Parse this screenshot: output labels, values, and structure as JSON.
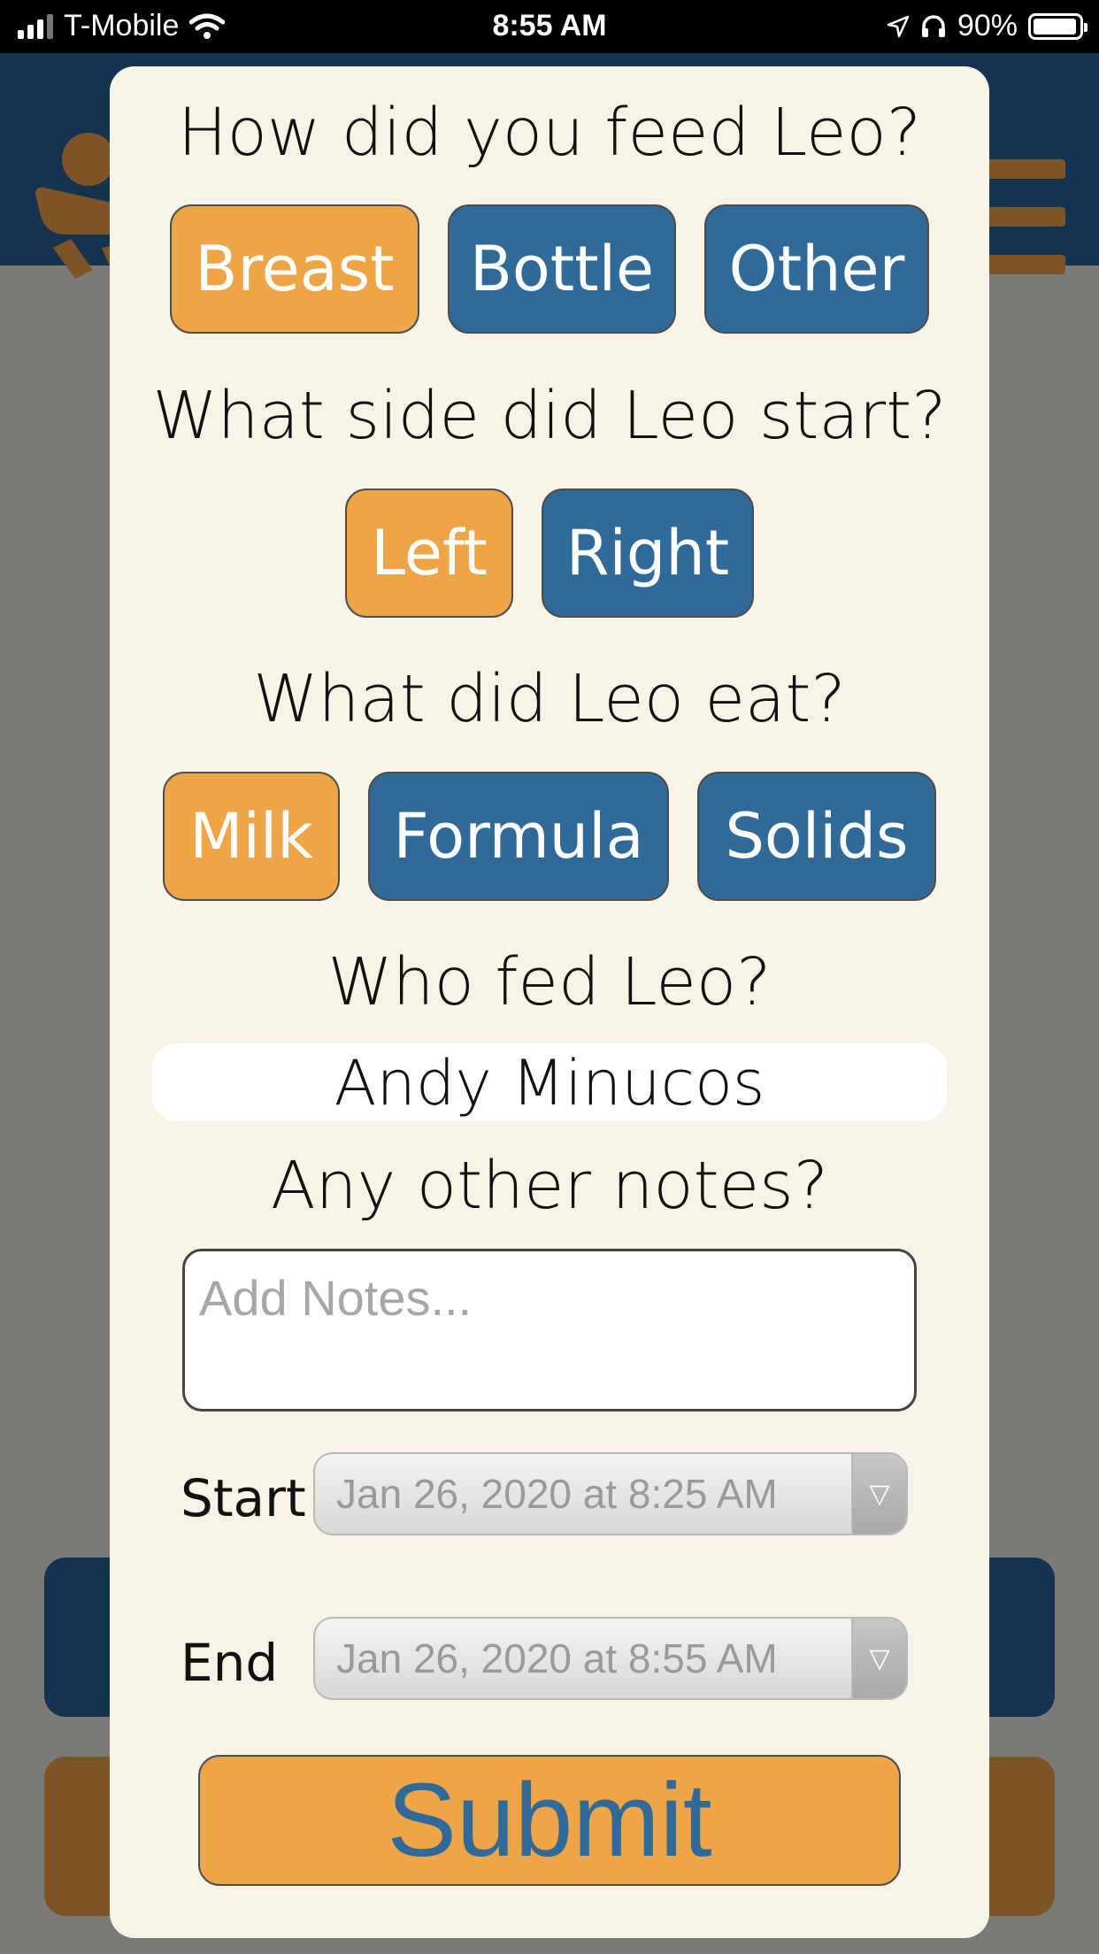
{
  "status_bar": {
    "carrier": "T-Mobile",
    "time": "8:55 AM",
    "battery": "90%"
  },
  "colors": {
    "selected": "#eea548",
    "unselected": "#2f6a98",
    "header": "#14344f",
    "modal_bg": "#f8f3e7"
  },
  "form": {
    "feed_question": "How did you feed Leo?",
    "feed_options": [
      "Breast",
      "Bottle",
      "Other"
    ],
    "feed_selected": "Breast",
    "side_question": "What side did Leo start?",
    "side_options": [
      "Left",
      "Right"
    ],
    "side_selected": "Left",
    "eat_question": "What did Leo eat?",
    "eat_options": [
      "Milk",
      "Formula",
      "Solids"
    ],
    "eat_selected": "Milk",
    "fed_by_question": "Who fed Leo?",
    "fed_by": "Andy Minucos",
    "notes_question": "Any other notes?",
    "notes_placeholder": "Add Notes...",
    "notes_value": "",
    "start_label": "Start",
    "start_value": "Jan 26, 2020 at 8:25 AM",
    "end_label": "End",
    "end_value": "Jan 26, 2020 at 8:55 AM",
    "submit_label": "Submit"
  }
}
